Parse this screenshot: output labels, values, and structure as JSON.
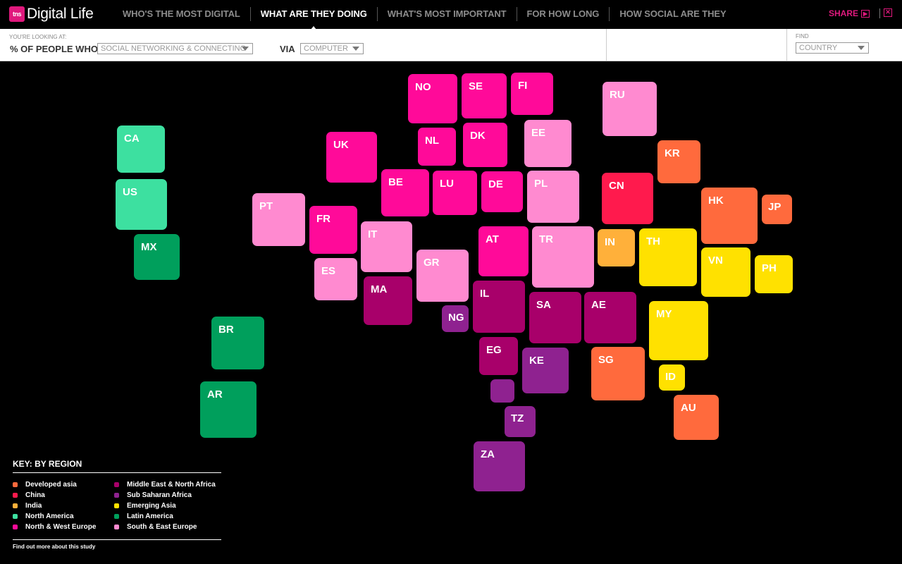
{
  "header": {
    "logo_mark": "tns",
    "logo_text": "Digital Life",
    "nav": [
      {
        "label": "Who's the most digital"
      },
      {
        "label": "What are they doing"
      },
      {
        "label": "What's most important"
      },
      {
        "label": "For how long"
      },
      {
        "label": "How social are they"
      }
    ],
    "active_nav": 1,
    "share_label": "SHARE",
    "close_label": "✕"
  },
  "filters": {
    "looking_label": "You're looking at:",
    "people_label": "% OF PEOPLE WHO:",
    "activity_value": "Social networking & connecting",
    "via_label": "VIA",
    "device_value": "Computer",
    "find_label": "Find",
    "country_value": "Country"
  },
  "regions": {
    "developed_asia": {
      "label": "Developed asia",
      "color": "#ff6a3d"
    },
    "china": {
      "label": "China",
      "color": "#ff1a4d"
    },
    "india": {
      "label": "India",
      "color": "#ffb03a"
    },
    "north_america": {
      "label": "North America",
      "color": "#3de0a0"
    },
    "nw_europe": {
      "label": "North & West Europe",
      "color": "#ff0a99"
    },
    "mena": {
      "label": "Middle East & North Africa",
      "color": "#a8006a"
    },
    "ssa": {
      "label": "Sub Saharan Africa",
      "color": "#8f2290"
    },
    "emerging_asia": {
      "label": "Emerging Asia",
      "color": "#ffe100"
    },
    "latin_america": {
      "label": "Latin America",
      "color": "#009f5c"
    },
    "se_europe": {
      "label": "South & East Europe",
      "color": "#ff8ad0"
    }
  },
  "key": {
    "title": "KEY: BY REGION",
    "col1": [
      "developed_asia",
      "china",
      "india",
      "north_america",
      "nw_europe"
    ],
    "col2": [
      "mena",
      "ssa",
      "emerging_asia",
      "latin_america",
      "se_europe"
    ],
    "footer": "Find out more about this study"
  },
  "countries": [
    {
      "code": "NO",
      "region": "nw_europe"
    },
    {
      "code": "SE",
      "region": "nw_europe"
    },
    {
      "code": "FI",
      "region": "nw_europe"
    },
    {
      "code": "RU",
      "region": "se_europe"
    },
    {
      "code": "CA",
      "region": "north_america"
    },
    {
      "code": "UK",
      "region": "nw_europe"
    },
    {
      "code": "NL",
      "region": "nw_europe"
    },
    {
      "code": "DK",
      "region": "nw_europe"
    },
    {
      "code": "EE",
      "region": "se_europe"
    },
    {
      "code": "KR",
      "region": "developed_asia"
    },
    {
      "code": "US",
      "region": "north_america"
    },
    {
      "code": "BE",
      "region": "nw_europe"
    },
    {
      "code": "LU",
      "region": "nw_europe"
    },
    {
      "code": "DE",
      "region": "nw_europe"
    },
    {
      "code": "PL",
      "region": "se_europe"
    },
    {
      "code": "CN",
      "region": "china"
    },
    {
      "code": "HK",
      "region": "developed_asia"
    },
    {
      "code": "JP",
      "region": "developed_asia"
    },
    {
      "code": "PT",
      "region": "se_europe"
    },
    {
      "code": "FR",
      "region": "nw_europe"
    },
    {
      "code": "IT",
      "region": "se_europe"
    },
    {
      "code": "MX",
      "region": "latin_america"
    },
    {
      "code": "AT",
      "region": "nw_europe"
    },
    {
      "code": "TR",
      "region": "se_europe"
    },
    {
      "code": "IN",
      "region": "india"
    },
    {
      "code": "TH",
      "region": "emerging_asia"
    },
    {
      "code": "VN",
      "region": "emerging_asia"
    },
    {
      "code": "PH",
      "region": "emerging_asia"
    },
    {
      "code": "ES",
      "region": "se_europe"
    },
    {
      "code": "GR",
      "region": "se_europe"
    },
    {
      "code": "MA",
      "region": "mena"
    },
    {
      "code": "IL",
      "region": "mena"
    },
    {
      "code": "SA",
      "region": "mena"
    },
    {
      "code": "AE",
      "region": "mena"
    },
    {
      "code": "NG",
      "region": "ssa"
    },
    {
      "code": "MY",
      "region": "emerging_asia"
    },
    {
      "code": "BR",
      "region": "latin_america"
    },
    {
      "code": "EG",
      "region": "mena"
    },
    {
      "code": "KE",
      "region": "ssa"
    },
    {
      "code": "SG",
      "region": "developed_asia"
    },
    {
      "code": "ID",
      "region": "emerging_asia"
    },
    {
      "code": "",
      "region": "ssa"
    },
    {
      "code": "AR",
      "region": "latin_america"
    },
    {
      "code": "TZ",
      "region": "ssa"
    },
    {
      "code": "AU",
      "region": "developed_asia"
    },
    {
      "code": "ZA",
      "region": "ssa"
    }
  ]
}
